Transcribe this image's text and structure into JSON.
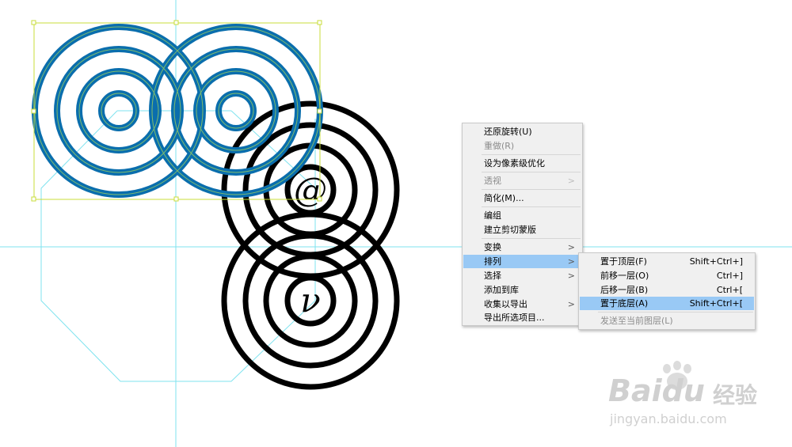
{
  "colors": {
    "guide": "#7fe3ef",
    "bounding_box": "#c8dc3a",
    "selected_stroke": "#0a6ead",
    "menu_highlight": "#99c9f5"
  },
  "artwork": {
    "glyph_at": "@",
    "glyph_nu": "ν"
  },
  "context_menu": {
    "items": [
      {
        "label": "还原旋转(U)",
        "disabled": false
      },
      {
        "label": "重做(R)",
        "disabled": true
      },
      {
        "label": "设为像素级优化",
        "disabled": false
      },
      {
        "label": "透视",
        "disabled": true,
        "submenu": true
      },
      {
        "label": "简化(M)...",
        "disabled": false
      },
      {
        "label": "编组",
        "disabled": false
      },
      {
        "label": "建立剪切蒙版",
        "disabled": false
      },
      {
        "label": "变换",
        "disabled": false,
        "submenu": true
      },
      {
        "label": "排列",
        "disabled": false,
        "submenu": true,
        "highlighted": true
      },
      {
        "label": "选择",
        "disabled": false,
        "submenu": true
      },
      {
        "label": "添加到库",
        "disabled": false
      },
      {
        "label": "收集以导出",
        "disabled": false,
        "submenu": true
      },
      {
        "label": "导出所选项目...",
        "disabled": false
      }
    ]
  },
  "arrange_submenu": {
    "items": [
      {
        "label": "置于顶层(F)",
        "shortcut": "Shift+Ctrl+]"
      },
      {
        "label": "前移一层(O)",
        "shortcut": "Ctrl+]"
      },
      {
        "label": "后移一层(B)",
        "shortcut": "Ctrl+["
      },
      {
        "label": "置于底层(A)",
        "shortcut": "Shift+Ctrl+[",
        "highlighted": true
      },
      {
        "label": "发送至当前图层(L)",
        "shortcut": "",
        "disabled": true
      }
    ]
  },
  "watermark": {
    "brand": "Baidu",
    "brand_cn": "经验",
    "url": "jingyan.baidu.com"
  }
}
